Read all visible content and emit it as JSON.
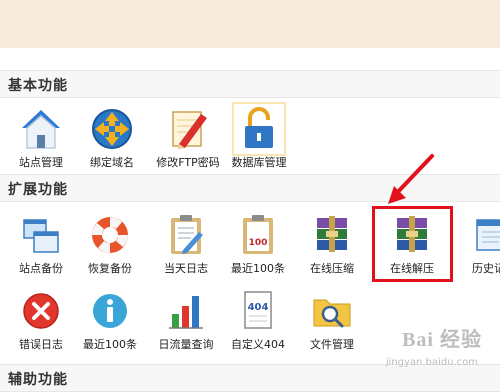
{
  "colors": {
    "top_band": "#f6ebdd",
    "section_header_bg": "#f7f7f7",
    "highlight": "#e1121b",
    "arrow": "#e1121b"
  },
  "sections": {
    "basic": {
      "title": "基本功能"
    },
    "extended": {
      "title": "扩展功能"
    },
    "auxiliary": {
      "title": "辅助功能"
    }
  },
  "basic_tiles": [
    {
      "label": "站点管理",
      "icon": "house-icon"
    },
    {
      "label": "绑定域名",
      "icon": "globe-arrows-icon"
    },
    {
      "label": "修改FTP密码",
      "icon": "pencil-notebook-icon"
    },
    {
      "label": "数据库管理",
      "icon": "padlock-icon"
    }
  ],
  "ext_row1": [
    {
      "label": "站点备份",
      "icon": "windows-stack-icon"
    },
    {
      "label": "恢复备份",
      "icon": "life-ring-icon"
    },
    {
      "label": "当天日志",
      "icon": "clipboard-icon"
    },
    {
      "label": "最近100条",
      "icon": "clipboard-100-icon"
    },
    {
      "label": "在线压缩",
      "icon": "winrar-icon"
    },
    {
      "label": "在线解压",
      "icon": "winrar-icon"
    },
    {
      "label": "历史记录",
      "icon": "window-icon"
    }
  ],
  "ext_row2": [
    {
      "label": "错误日志",
      "icon": "error-x-icon"
    },
    {
      "label": "最近100条",
      "icon": "info-icon"
    },
    {
      "label": "日流量查询",
      "icon": "bar-chart-icon"
    },
    {
      "label": "自定义404",
      "icon": "page-404-icon",
      "icon_text": "404"
    },
    {
      "label": "文件管理",
      "icon": "folder-search-icon"
    }
  ],
  "watermark": {
    "text": "Bai 经验",
    "sub": "jingyan.baidu.com"
  }
}
